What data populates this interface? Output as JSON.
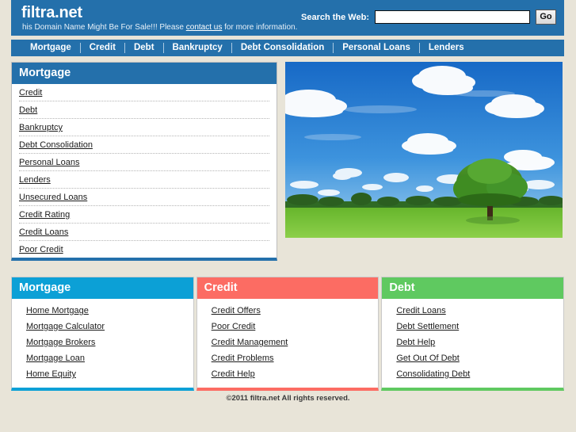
{
  "header": {
    "brand": "filtra.net",
    "tagline_before": "his Domain Name Might Be For Sale!!! Please ",
    "tagline_link": "contact us",
    "tagline_after": " for more information.",
    "search_label": "Search the Web:",
    "search_value": "",
    "search_placeholder": "",
    "go_label": "Go"
  },
  "nav": {
    "items": [
      {
        "label": "Mortgage"
      },
      {
        "label": "Credit"
      },
      {
        "label": "Debt"
      },
      {
        "label": "Bankruptcy"
      },
      {
        "label": "Debt Consolidation"
      },
      {
        "label": "Personal Loans"
      },
      {
        "label": "Lenders"
      }
    ]
  },
  "main_panel": {
    "title": "Mortgage",
    "accent": "#2470ab",
    "links": [
      {
        "label": "Credit"
      },
      {
        "label": "Debt"
      },
      {
        "label": "Bankruptcy"
      },
      {
        "label": "Debt Consolidation"
      },
      {
        "label": "Personal Loans"
      },
      {
        "label": "Lenders"
      },
      {
        "label": "Unsecured Loans"
      },
      {
        "label": "Credit Rating"
      },
      {
        "label": "Credit Loans"
      },
      {
        "label": "Poor Credit"
      }
    ]
  },
  "hero": {
    "alt": "Green field with a lone tree under a blue sky with clouds",
    "sky_color": "#2a7fd0",
    "field_color": "#6fbb33",
    "cloud_color": "#ffffff"
  },
  "boxes": [
    {
      "title": "Mortgage",
      "accent": "#0ca0d6",
      "links": [
        {
          "label": "Home Mortgage"
        },
        {
          "label": "Mortgage Calculator"
        },
        {
          "label": "Mortgage Brokers"
        },
        {
          "label": "Mortgage Loan"
        },
        {
          "label": "Home Equity"
        }
      ]
    },
    {
      "title": "Credit",
      "accent": "#fc6c63",
      "links": [
        {
          "label": "Credit Offers"
        },
        {
          "label": "Poor Credit"
        },
        {
          "label": "Credit Management"
        },
        {
          "label": "Credit Problems"
        },
        {
          "label": "Credit Help"
        }
      ]
    },
    {
      "title": "Debt",
      "accent": "#5fc960",
      "links": [
        {
          "label": "Credit Loans"
        },
        {
          "label": "Debt Settlement"
        },
        {
          "label": "Debt Help"
        },
        {
          "label": "Get Out Of Debt"
        },
        {
          "label": "Consolidating Debt"
        }
      ]
    }
  ],
  "footer": {
    "copyright": "©2011 filtra.net All rights reserved."
  }
}
